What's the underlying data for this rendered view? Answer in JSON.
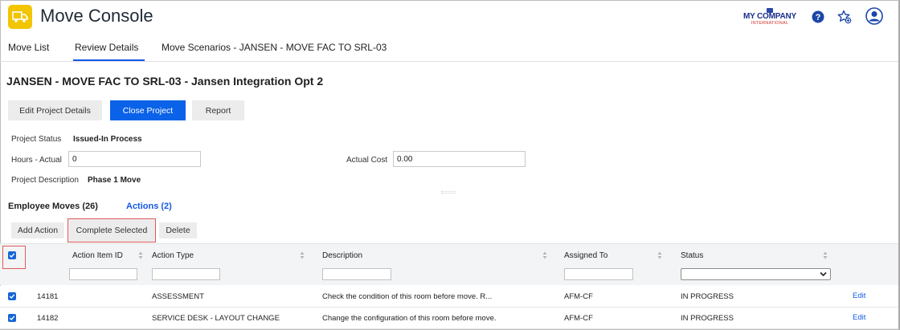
{
  "app": {
    "title": "Move Console",
    "accent": "#F2C500",
    "primary_color": "#0A62E8"
  },
  "header": {
    "logo": {
      "main": "MY COMPANY",
      "sub": "INTERNATIONAL"
    },
    "icons": [
      "help-icon",
      "favorites-star-icon",
      "user-avatar-icon"
    ]
  },
  "tabs": [
    {
      "label": "Move List",
      "active": false
    },
    {
      "label": "Review Details",
      "active": true
    },
    {
      "label": "Move Scenarios - JANSEN - MOVE FAC TO SRL-03",
      "active": false
    }
  ],
  "page": {
    "title": "JANSEN - MOVE FAC TO SRL-03 - Jansen Integration Opt 2",
    "buttons": {
      "edit_project": "Edit Project Details",
      "close_project": "Close Project",
      "report": "Report"
    }
  },
  "details": {
    "status_label": "Project Status",
    "status_value": "Issued-In Process",
    "hours_label": "Hours - Actual",
    "hours_value": "0",
    "cost_label": "Actual Cost",
    "cost_value": "0.00",
    "description_label": "Project Description",
    "description_value": "Phase 1 Move"
  },
  "subtabs": {
    "employee_moves": "Employee Moves (26)",
    "actions": "Actions (2)"
  },
  "actions_toolbar": {
    "add": "Add Action",
    "complete": "Complete Selected",
    "delete": "Delete"
  },
  "grid": {
    "columns": [
      "Action Item ID",
      "Action Type",
      "Description",
      "Assigned To",
      "Status"
    ],
    "select_all_checked": true,
    "rows": [
      {
        "checked": true,
        "id": "14181",
        "type": "ASSESSMENT",
        "description": "Check the condition of this room before move. R...",
        "assigned": "AFM-CF",
        "status": "IN PROGRESS",
        "action": "Edit"
      },
      {
        "checked": true,
        "id": "14182",
        "type": "SERVICE DESK - LAYOUT CHANGE",
        "description": "Change the configuration of this room before move.",
        "assigned": "AFM-CF",
        "status": "IN PROGRESS",
        "action": "Edit"
      }
    ]
  }
}
